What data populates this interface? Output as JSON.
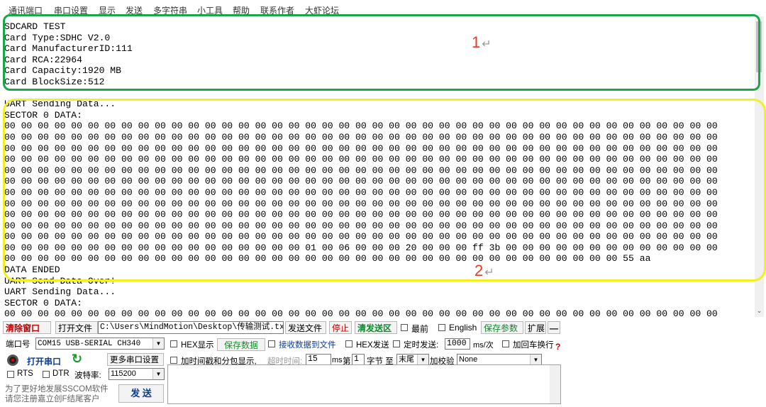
{
  "menu": [
    "通讯端口",
    "串口设置",
    "显示",
    "发送",
    "多字符串",
    "小工具",
    "帮助",
    "联系作者",
    "大虾论坛"
  ],
  "terminal": {
    "lines": [
      "SDCARD TEST",
      "Card Type:SDHC V2.0",
      "Card ManufacturerID:111",
      "Card RCA:22964",
      "Card Capacity:1920 MB",
      "Card BlockSize:512",
      "",
      "UART Sending Data...",
      "SECTOR 0 DATA:",
      "00 00 00 00 00 00 00 00 00 00 00 00 00 00 00 00 00 00 00 00 00 00 00 00 00 00 00 00 00 00 00 00 00 00 00 00 00 00 00 00 00 00 00",
      "00 00 00 00 00 00 00 00 00 00 00 00 00 00 00 00 00 00 00 00 00 00 00 00 00 00 00 00 00 00 00 00 00 00 00 00 00 00 00 00 00 00 00",
      "00 00 00 00 00 00 00 00 00 00 00 00 00 00 00 00 00 00 00 00 00 00 00 00 00 00 00 00 00 00 00 00 00 00 00 00 00 00 00 00 00 00 00",
      "00 00 00 00 00 00 00 00 00 00 00 00 00 00 00 00 00 00 00 00 00 00 00 00 00 00 00 00 00 00 00 00 00 00 00 00 00 00 00 00 00 00 00",
      "00 00 00 00 00 00 00 00 00 00 00 00 00 00 00 00 00 00 00 00 00 00 00 00 00 00 00 00 00 00 00 00 00 00 00 00 00 00 00 00 00 00 00",
      "00 00 00 00 00 00 00 00 00 00 00 00 00 00 00 00 00 00 00 00 00 00 00 00 00 00 00 00 00 00 00 00 00 00 00 00 00 00 00 00 00 00 00",
      "00 00 00 00 00 00 00 00 00 00 00 00 00 00 00 00 00 00 00 00 00 00 00 00 00 00 00 00 00 00 00 00 00 00 00 00 00 00 00 00 00 00 00",
      "00 00 00 00 00 00 00 00 00 00 00 00 00 00 00 00 00 00 00 00 00 00 00 00 00 00 00 00 00 00 00 00 00 00 00 00 00 00 00 00 00 00 00",
      "00 00 00 00 00 00 00 00 00 00 00 00 00 00 00 00 00 00 00 00 00 00 00 00 00 00 00 00 00 00 00 00 00 00 00 00 00 00 00 00 00 00 00",
      "00 00 00 00 00 00 00 00 00 00 00 00 00 00 00 00 00 00 00 00 00 00 00 00 00 00 00 00 00 00 00 00 00 00 00 00 00 00 00 00 00 00 00",
      "00 00 00 00 00 00 00 00 00 00 00 00 00 00 00 00 00 00 00 00 00 00 00 00 00 00 00 00 00 00 00 00 00 00 00 00 00 00 00 00 00 00 00",
      "00 00 00 00 00 00 00 00 00 00 00 00 00 00 00 00 00 00 01 00 06 00 00 00 20 00 00 00 ff 3b 00 00 00 00 00 00 00 00 00 00 00 00 00",
      "00 00 00 00 00 00 00 00 00 00 00 00 00 00 00 00 00 00 00 00 00 00 00 00 00 00 00 00 00 00 00 00 00 00 00 00 00 55 aa",
      "DATA ENDED",
      "UART Send Data Over!",
      "UART Sending Data...",
      "SECTOR 0 DATA:",
      "00 00 00 00 00 00 00 00 00 00 00 00 00 00 00 00 00 00 00 00 00 00 00 00 00 00 00 00 00 00 00 00 00 00 00 00 00 00 00 00 00 00 00"
    ]
  },
  "annotations": {
    "box1": "1",
    "box2": "2",
    "return_mark": "↵"
  },
  "toolbar": {
    "clear_window": "清除窗口",
    "open_file": "打开文件",
    "file_path": "C:\\Users\\MindMotion\\Desktop\\传输测试.txt",
    "send_file": "发送文件",
    "stop": "停止",
    "clear_send": "清发送区",
    "topmost": "最前",
    "english": "English",
    "save_params": "保存参数",
    "expand": "扩展",
    "collapse": "—"
  },
  "port": {
    "port_label": "端口号",
    "port_value": "COM15 USB-SERIAL CH340",
    "open_port": "打开串口",
    "more_settings": "更多串口设置",
    "rts": "RTS",
    "dtr": "DTR",
    "baud_label": "波特率:",
    "baud_value": "115200"
  },
  "options": {
    "hex_display": "HEX显示",
    "save_data": "保存数据",
    "recv_to_file": "接收数据到文件",
    "hex_send": "HEX发送",
    "timed_send": "定时发送:",
    "interval": "1000",
    "interval_unit": "ms/次",
    "add_crlf": "加回车换行",
    "timestamp": "加时间戳和分包显示,",
    "timeout_label": "超时时间:",
    "timeout_value": "15",
    "timeout_unit": "ms",
    "byte_prefix": "第",
    "byte_value": "1",
    "byte_to": "字节 至",
    "byte_end": "末尾",
    "checksum_label": "加校验",
    "checksum_value": "None"
  },
  "send_button": "发 送",
  "promo": [
    "为了更好地发展SSCOM软件",
    "请您注册嘉立创F结尾客户"
  ],
  "colors": {
    "box1": "#18a84a",
    "box2": "#f2ef22",
    "annotation": "#e23d2a"
  }
}
